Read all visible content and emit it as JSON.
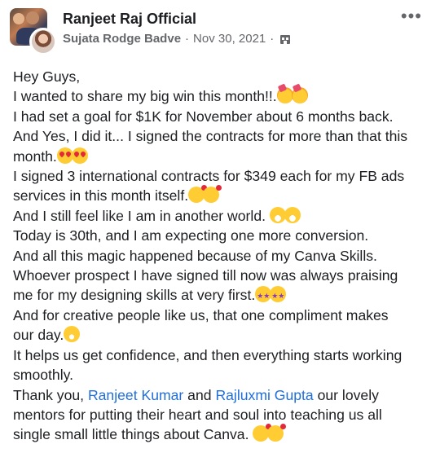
{
  "post": {
    "group_name": "Ranjeet Raj Official",
    "author": "Sujata Rodge Badve",
    "separator": "·",
    "date": "Nov 30, 2021",
    "more_icon": "more-horizontal-icon",
    "privacy_icon": "group-privacy-icon"
  },
  "body": {
    "l1": "Hey Guys,",
    "l2": "I wanted to share my big win this month!!.",
    "l3": "I had set a goal for $1K for November about 6 months back.",
    "l4": "And Yes, I did it... I signed the contracts for more than that this",
    "l5": "month.",
    "l6": "I signed 3 international contracts for $349 each for my FB ads",
    "l7": "services in this month itself.",
    "l8": "And I still feel like I am in another world. ",
    "l9": "Today is 30th, and I am expecting one more conversion.",
    "l10": "And all this magic happened because of my Canva Skills.",
    "l11": "Whoever prospect I have signed till now was always praising",
    "l12": "me for my designing skills at very first.",
    "l13": "And for creative people like us, that one compliment makes",
    "l14": "our day.",
    "l15": "It helps us get confidence, and then everything starts working",
    "l16": "smoothly.",
    "l17_pre": "Thank you, ",
    "mention1": "Ranjeet Kumar",
    "l17_mid": " and ",
    "mention2": "Rajluxmi Gupta",
    "l17_post": " our lovely",
    "l18": "mentors for putting their heart and soul into teaching us all",
    "l19": "single small little things about Canva. "
  },
  "emojis": {
    "party": "partying-face-icon",
    "heart_eyes": "heart-eyes-icon",
    "hearts": "smiling-face-with-hearts-icon",
    "grin": "grinning-sweat-icon",
    "stars": "star-struck-icon",
    "smile": "grinning-face-icon"
  },
  "colors": {
    "mention": "#216fdb",
    "meta": "#65676b",
    "text": "#1c1e21"
  }
}
